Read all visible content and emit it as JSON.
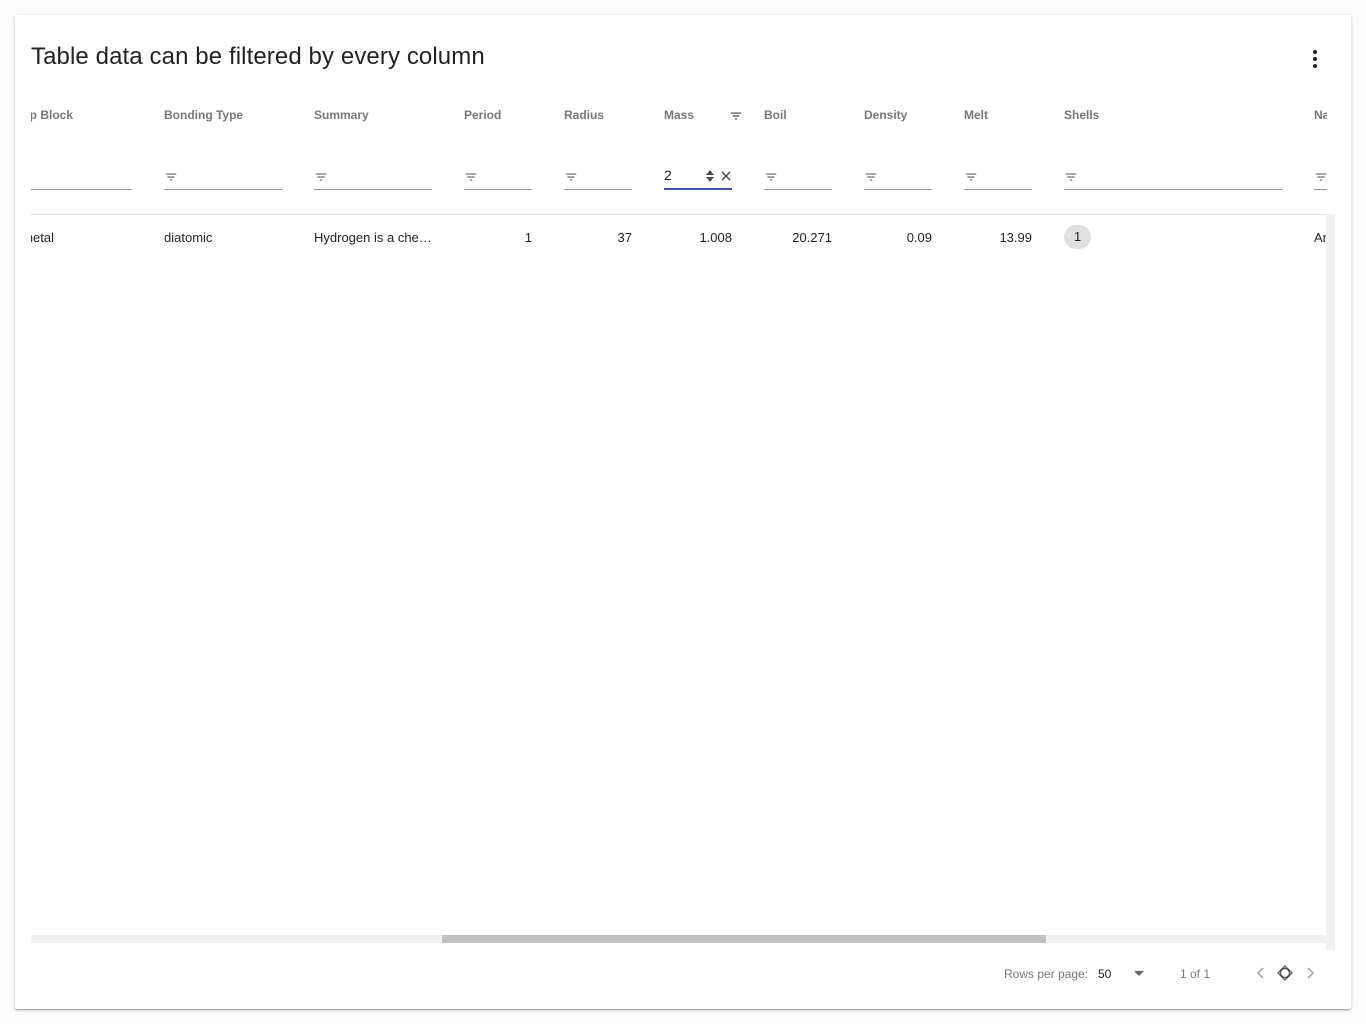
{
  "title": "Table data can be filtered by every column",
  "icons": {
    "more": "more-vert-icon",
    "filter": "filter-list-icon",
    "clear": "close-icon",
    "spinner": "number-spinner-icon",
    "dropdown": "arrow-drop-down-icon",
    "prev": "chevron-left-icon",
    "reset": "reset-page-icon",
    "next": "chevron-right-icon"
  },
  "columns": [
    {
      "key": "group_block",
      "label": "oup Block"
    },
    {
      "key": "bonding_type",
      "label": "Bonding Type"
    },
    {
      "key": "summary",
      "label": "Summary"
    },
    {
      "key": "period",
      "label": "Period"
    },
    {
      "key": "radius",
      "label": "Radius"
    },
    {
      "key": "mass",
      "label": "Mass"
    },
    {
      "key": "boil",
      "label": "Boil"
    },
    {
      "key": "density",
      "label": "Density"
    },
    {
      "key": "melt",
      "label": "Melt"
    },
    {
      "key": "shells",
      "label": "Shells"
    },
    {
      "key": "name",
      "label": "Na"
    }
  ],
  "filters": {
    "mass": "2"
  },
  "rows": [
    {
      "group_block": "nmetal",
      "bonding_type": "diatomic",
      "summary": "Hydrogen is a che…",
      "period": "1",
      "radius": "37",
      "mass": "1.008",
      "boil": "20.271",
      "density": "0.09",
      "melt": "13.99",
      "shells": "1",
      "name": "Ar"
    }
  ],
  "footer": {
    "rows_per_page_label": "Rows per page:",
    "rows_per_page_value": "50",
    "page_range": "1 of 1"
  },
  "colors": {
    "accent": "#3f51b5",
    "chip": "#e0e0e0"
  }
}
